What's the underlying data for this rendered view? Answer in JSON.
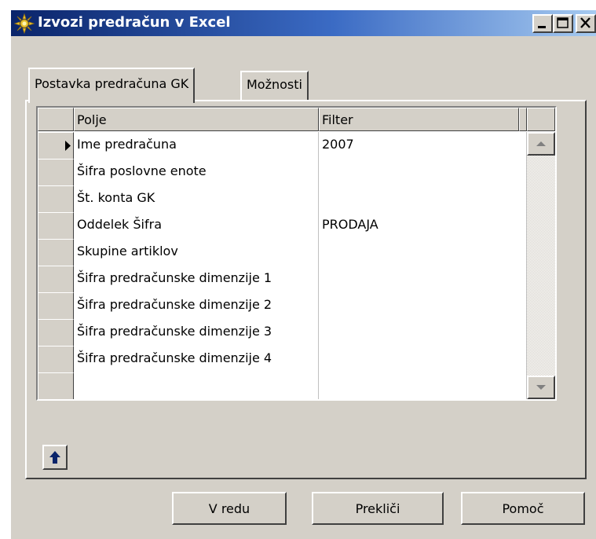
{
  "window": {
    "title": "Izvozi predračun v Excel",
    "controls": [
      "minimize-icon",
      "maximize-icon",
      "close-icon"
    ]
  },
  "tabs": [
    {
      "label": "Postavka predračuna GK",
      "active": true
    },
    {
      "label": "Možnosti",
      "active": false
    }
  ],
  "grid": {
    "columns": [
      "Polje",
      "Filter"
    ],
    "rows": [
      {
        "field": "Ime predračuna",
        "filter": "2007",
        "current": true
      },
      {
        "field": "Šifra poslovne enote",
        "filter": ""
      },
      {
        "field": "Št. konta GK",
        "filter": ""
      },
      {
        "field": "Oddelek Šifra",
        "filter": "PRODAJA"
      },
      {
        "field": "Skupine artiklov",
        "filter": ""
      },
      {
        "field": "Šifra predračunske dimenzije 1",
        "filter": ""
      },
      {
        "field": "Šifra predračunske dimenzije 2",
        "filter": ""
      },
      {
        "field": "Šifra predračunske dimenzije 3",
        "filter": ""
      },
      {
        "field": "Šifra predračunske dimenzije 4",
        "filter": ""
      },
      {
        "field": "",
        "filter": ""
      }
    ]
  },
  "buttons": {
    "ok": "V redu",
    "cancel": "Prekliči",
    "help": "Pomoč"
  },
  "colors": {
    "titlebar_start": "#0a246a",
    "titlebar_end": "#a6caf0",
    "face": "#d4d0c8",
    "arrow_icon": "#0a246a"
  }
}
